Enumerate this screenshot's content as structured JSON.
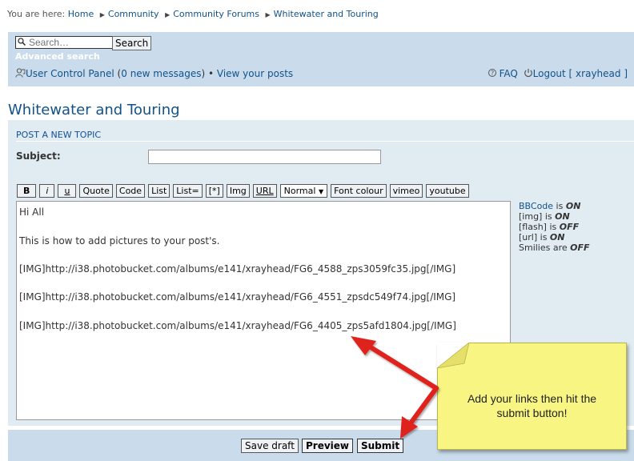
{
  "breadcrumb": {
    "prefix": "You are here:",
    "items": [
      "Home",
      "Community",
      "Community Forums",
      "Whitewater and Touring"
    ]
  },
  "header": {
    "search_placeholder": "Search…",
    "search_button": "Search",
    "advanced_search": "Advanced search",
    "ucp_label": "User Control Panel",
    "ucp_open": " (",
    "new_messages_count": "0",
    "new_messages_label": " new messages",
    "ucp_close": ") • ",
    "view_posts": "View your posts",
    "faq": "FAQ",
    "logout": "Logout [ xrayhead ]"
  },
  "page": {
    "title": "Whitewater and Touring",
    "panel_heading": "POST A NEW TOPIC",
    "subject_label": "Subject:",
    "subject_value": ""
  },
  "toolbar": {
    "bold": "B",
    "italic": "i",
    "underline": "u",
    "quote": "Quote",
    "code": "Code",
    "list": "List",
    "list_ordered": "List=",
    "list_item": "[*]",
    "img": "Img",
    "url": "URL",
    "font_size": "Normal",
    "font_colour": "Font colour",
    "vimeo": "vimeo",
    "youtube": "youtube"
  },
  "editor": {
    "lines": [
      "Hi All",
      "This is how to add pictures to your post's.",
      "[IMG]http://i38.photobucket.com/albums/e141/xrayhead/FG6_4588_zps3059fc35.jpg[/IMG]",
      "[IMG]http://i38.photobucket.com/albums/e141/xrayhead/FG6_4551_zpsdc549f74.jpg[/IMG]",
      "[IMG]http://i38.photobucket.com/albums/e141/xrayhead/FG6_4405_zps5afd1804.jpg[/IMG]"
    ]
  },
  "status": {
    "bbcode_label": "BBCode",
    "bbcode_state": "ON",
    "img_label": "[img]",
    "img_state": "ON",
    "flash_label": "[flash]",
    "flash_state": "OFF",
    "url_label": "[url]",
    "url_state": "ON",
    "smilies_label": "Smilies",
    "smilies_state": "OFF",
    "is": " is ",
    "are": " are "
  },
  "buttons": {
    "save_draft": "Save draft",
    "preview": "Preview",
    "submit": "Submit"
  },
  "annotation": {
    "note_line1": "Add your links then hit the",
    "note_line2": "submit button!",
    "arrow_color": "#e0201c",
    "note_color": "#f8f583"
  }
}
